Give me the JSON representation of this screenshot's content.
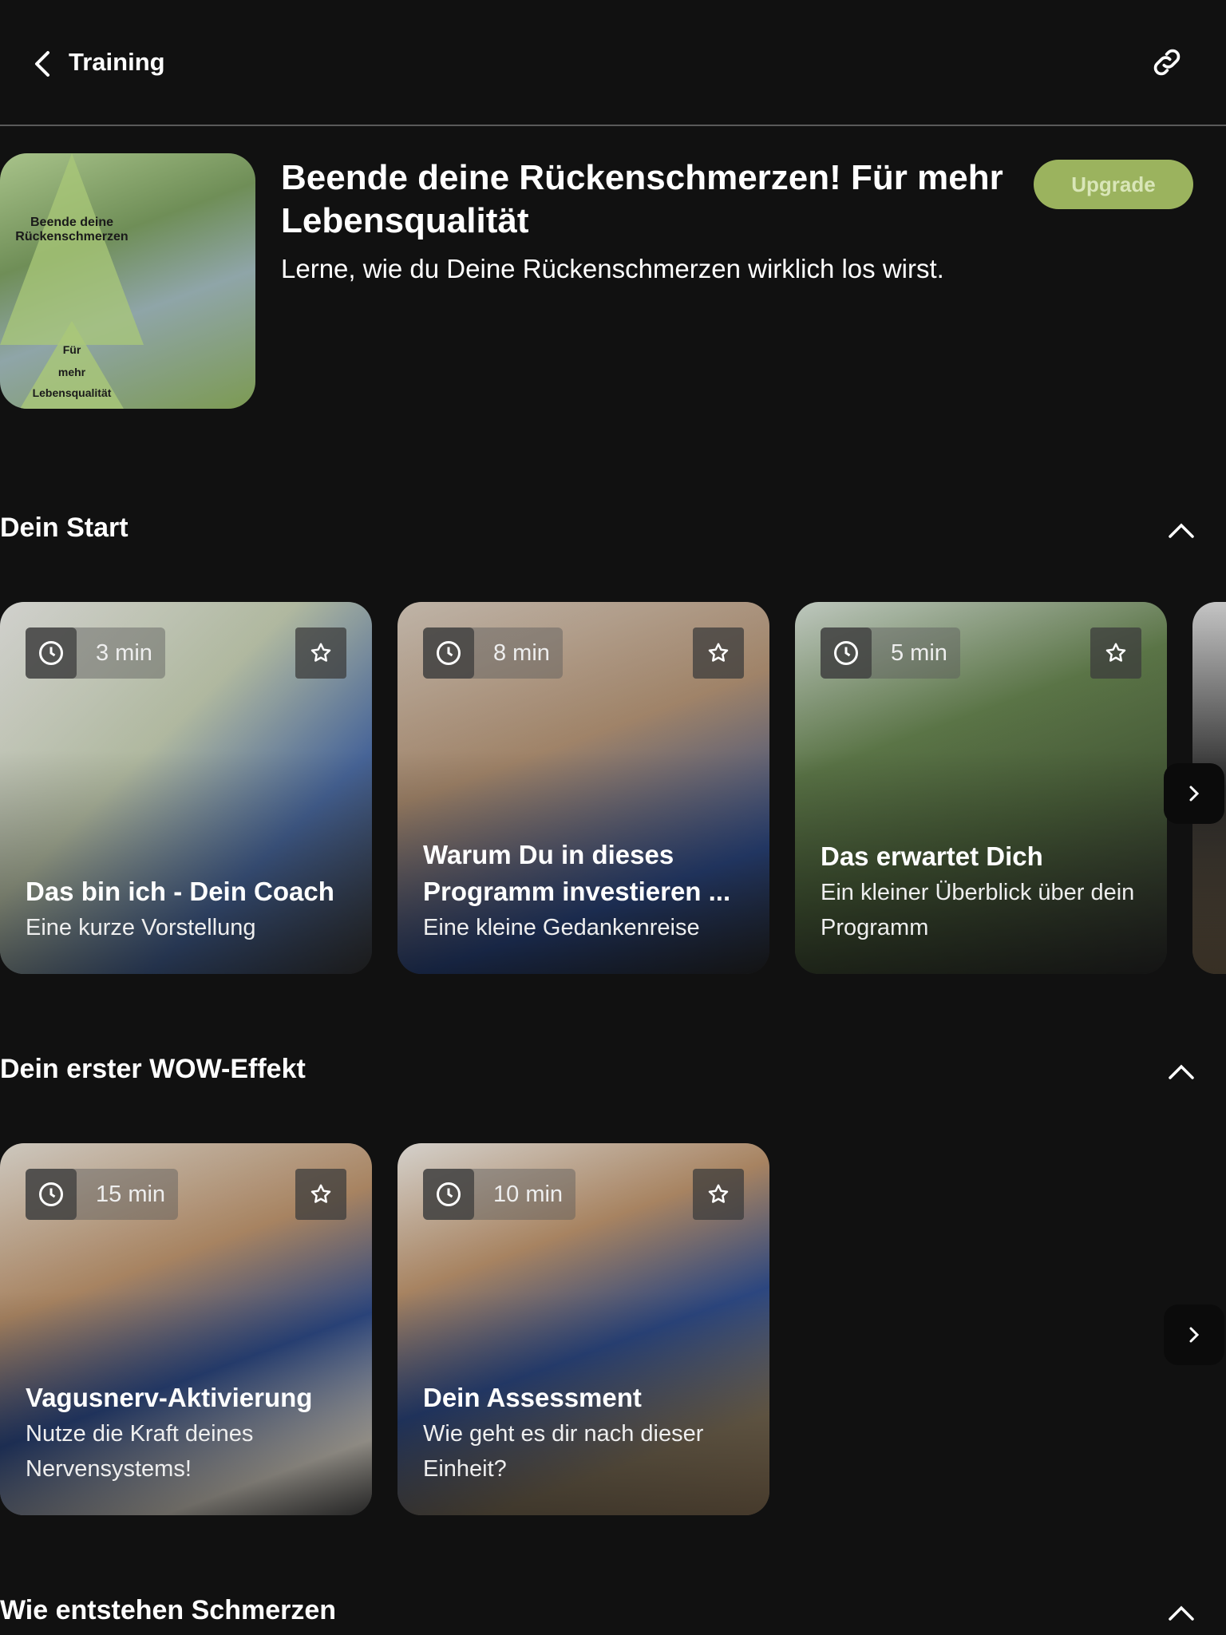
{
  "header": {
    "title": "Training",
    "back_icon": "chevron-left-icon",
    "share_icon": "link-icon"
  },
  "program": {
    "title": "Beende deine Rückenschmerzen! Für mehr Lebensqualität",
    "subtitle": "Lerne, wie du Deine Rückenschmerzen wirklich los wirst.",
    "upgrade_label": "Upgrade",
    "accent": "#9bb35e",
    "image_text": [
      "Beende deine Rückenschmerzen",
      "Für",
      "mehr",
      "Lebensqualität"
    ]
  },
  "sections": [
    {
      "title": "Dein Start",
      "cards": [
        {
          "duration": "3 min",
          "title": "Das bin ich - Dein Coach",
          "subtitle": "Eine kurze Vorstellung"
        },
        {
          "duration": "8 min",
          "title": "Warum Du in dieses Programm investieren ...",
          "subtitle": "Eine kleine Gedankenreise"
        },
        {
          "duration": "5 min",
          "title": "Das erwartet Dich",
          "subtitle": "Ein kleiner Überblick über dein Programm"
        }
      ]
    },
    {
      "title": "Dein erster WOW-Effekt",
      "cards": [
        {
          "duration": "15 min",
          "title": "Vagusnerv-Aktivierung",
          "subtitle": "Nutze die Kraft deines Nervensystems!"
        },
        {
          "duration": "10 min",
          "title": "Dein Assessment",
          "subtitle": "Wie geht es dir nach dieser Einheit?"
        }
      ]
    },
    {
      "title": "Wie entstehen Schmerzen",
      "cards": []
    }
  ]
}
